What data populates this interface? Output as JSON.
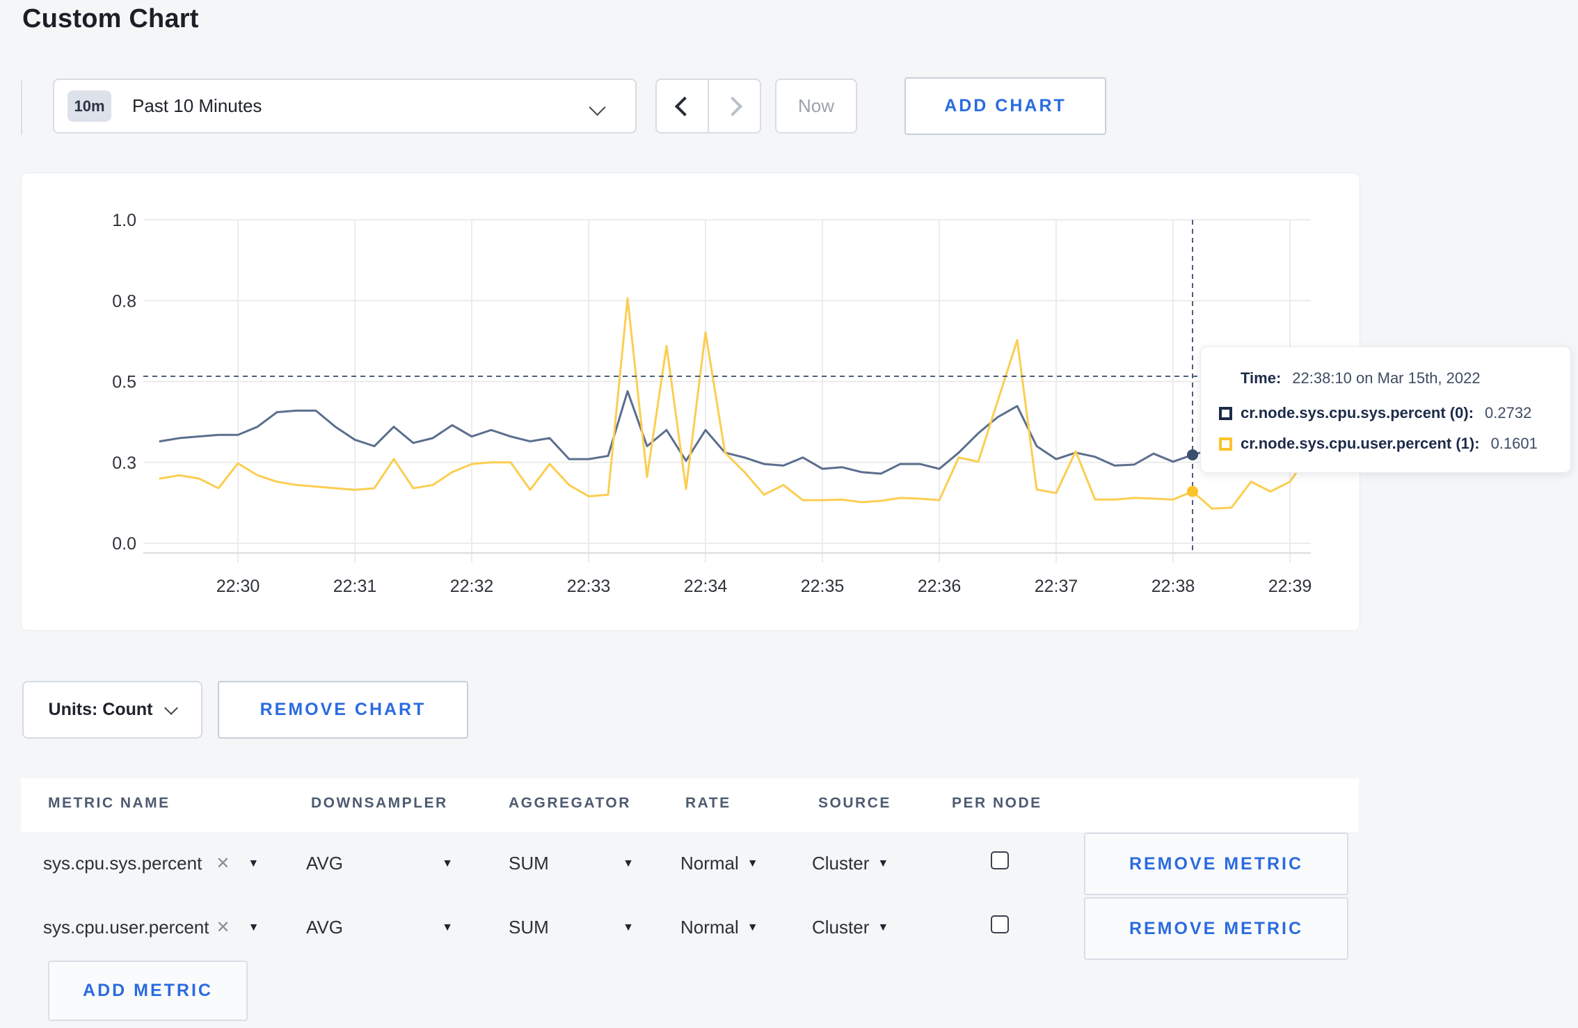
{
  "page": {
    "title": "Custom Chart"
  },
  "toolbar": {
    "time_window": {
      "badge": "10m",
      "label": "Past 10 Minutes"
    },
    "now_label": "Now",
    "add_chart_label": "ADD CHART"
  },
  "chart_data": {
    "type": "line",
    "title": "",
    "xlabel": "",
    "ylabel": "",
    "ylim": [
      0,
      1
    ],
    "grid": true,
    "x_start": "22:29:20",
    "x_step_seconds": 10,
    "x_ticks": [
      "22:30",
      "22:31",
      "22:32",
      "22:33",
      "22:34",
      "22:35",
      "22:36",
      "22:37",
      "22:38",
      "22:39"
    ],
    "y_ticks": [
      {
        "fraction": 0.0,
        "label": "0.0"
      },
      {
        "fraction": 0.25,
        "label": "0.3"
      },
      {
        "fraction": 0.5,
        "label": "0.5"
      },
      {
        "fraction": 0.75,
        "label": "0.8"
      },
      {
        "fraction": 1.0,
        "label": "1.0"
      }
    ],
    "series": [
      {
        "name": "cr.node.sys.cpu.sys.percent",
        "color": "#5b6e8e",
        "values": [
          0.315,
          0.325,
          0.33,
          0.335,
          0.335,
          0.36,
          0.405,
          0.41,
          0.41,
          0.36,
          0.32,
          0.3,
          0.36,
          0.31,
          0.325,
          0.365,
          0.33,
          0.35,
          0.33,
          0.315,
          0.325,
          0.26,
          0.26,
          0.27,
          0.47,
          0.3,
          0.35,
          0.255,
          0.35,
          0.28,
          0.265,
          0.245,
          0.24,
          0.265,
          0.23,
          0.235,
          0.22,
          0.215,
          0.245,
          0.245,
          0.23,
          0.28,
          0.34,
          0.39,
          0.424,
          0.3,
          0.26,
          0.28,
          0.267,
          0.24,
          0.243,
          0.277,
          0.252,
          0.2732,
          0.29,
          0.28,
          0.27,
          0.28,
          0.295,
          0.3
        ]
      },
      {
        "name": "cr.node.sys.cpu.user.percent",
        "color": "#fbce51",
        "values": [
          0.2,
          0.21,
          0.2,
          0.17,
          0.247,
          0.21,
          0.19,
          0.18,
          0.175,
          0.17,
          0.165,
          0.17,
          0.26,
          0.17,
          0.18,
          0.22,
          0.245,
          0.25,
          0.25,
          0.165,
          0.245,
          0.18,
          0.145,
          0.15,
          0.757,
          0.205,
          0.61,
          0.168,
          0.652,
          0.28,
          0.22,
          0.15,
          0.18,
          0.133,
          0.133,
          0.135,
          0.127,
          0.131,
          0.14,
          0.138,
          0.133,
          0.265,
          0.252,
          0.44,
          0.628,
          0.166,
          0.155,
          0.284,
          0.135,
          0.135,
          0.14,
          0.138,
          0.135,
          0.1601,
          0.107,
          0.11,
          0.19,
          0.16,
          0.19,
          0.277
        ]
      }
    ],
    "crosshair": {
      "x_index": 53,
      "hover_y_fraction": 0.516,
      "dot_values": [
        0.2732,
        0.1601
      ],
      "dot_colors": [
        "#3d4f6e",
        "#fdc32a"
      ]
    },
    "legend_position": "tooltip"
  },
  "tooltip": {
    "time_label": "Time:",
    "time_value": "22:38:10 on Mar 15th, 2022",
    "series": [
      {
        "name": "cr.node.sys.cpu.sys.percent (0):",
        "value": "0.2732",
        "color": "#1d2b49"
      },
      {
        "name": "cr.node.sys.cpu.user.percent (1):",
        "value": "0.1601",
        "color": "#fdc32a"
      }
    ]
  },
  "units": {
    "label": "Units: Count",
    "remove_chart_label": "REMOVE CHART"
  },
  "metrics_table": {
    "headers": [
      "METRIC NAME",
      "DOWNSAMPLER",
      "AGGREGATOR",
      "RATE",
      "SOURCE",
      "PER NODE"
    ],
    "remove_metric_label": "REMOVE METRIC",
    "add_metric_label": "ADD METRIC",
    "rows": [
      {
        "name": "sys.cpu.sys.percent",
        "downsampler": "AVG",
        "aggregator": "SUM",
        "rate": "Normal",
        "source": "Cluster",
        "per_node_checked": false
      },
      {
        "name": "sys.cpu.user.percent",
        "downsampler": "AVG",
        "aggregator": "SUM",
        "rate": "Normal",
        "source": "Cluster",
        "per_node_checked": false
      }
    ]
  },
  "colors": {
    "accent_blue": "#2a6be0",
    "page_background": "#f5f6f8",
    "gridline": "#ececec",
    "axis_line": "#d9dce1",
    "crosshair": "#4d5d79",
    "tick_text": "#2f333a"
  }
}
